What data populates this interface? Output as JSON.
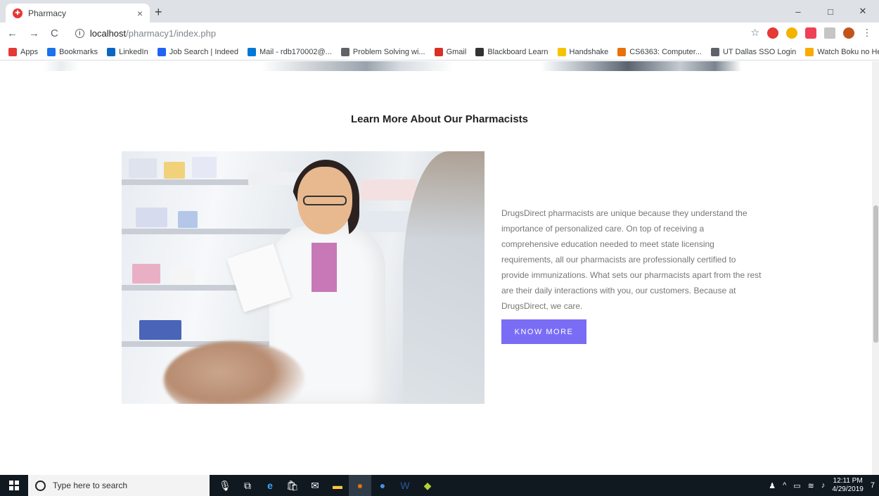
{
  "browser": {
    "tab_title": "Pharmacy",
    "tab_close": "×",
    "new_tab": "+",
    "url_host": "localhost",
    "url_path": "/pharmacy1/index.php",
    "window_minimize": "–",
    "window_maximize": "□",
    "window_close": "✕",
    "back": "←",
    "forward": "→",
    "reload": "C",
    "bookmarks": [
      {
        "label": "Apps",
        "color": "#e53935"
      },
      {
        "label": "Bookmarks",
        "color": "#1a73e8"
      },
      {
        "label": "LinkedIn",
        "color": "#0a66c2"
      },
      {
        "label": "Job Search | Indeed",
        "color": "#2164f3"
      },
      {
        "label": "Mail - rdb170002@...",
        "color": "#0078d4"
      },
      {
        "label": "Problem Solving wi...",
        "color": "#5f6368"
      },
      {
        "label": "Gmail",
        "color": "#d93025"
      },
      {
        "label": "Blackboard Learn",
        "color": "#333333"
      },
      {
        "label": "Handshake",
        "color": "#f5c400"
      },
      {
        "label": "CS6363: Computer...",
        "color": "#e8710a"
      },
      {
        "label": "UT Dallas SSO Login",
        "color": "#5f6368"
      },
      {
        "label": "Watch Boku no Her...",
        "color": "#f9ab00"
      }
    ],
    "bookmarks_more": "»"
  },
  "section": {
    "title": "Learn More About Our Pharmacists",
    "description": "DrugsDirect pharmacists are unique because they understand the importance of personalized care. On top of receiving a comprehensive education needed to meet state licensing requirements, all our pharmacists are professionally certified to provide immunizations. What sets our pharmacists apart from the rest are their daily interactions with you, our customers. Because at DrugsDirect, we care.",
    "button_label": "KNOW MORE"
  },
  "taskbar": {
    "search_placeholder": "Type here to search",
    "time": "12:11 PM",
    "date": "4/29/2019",
    "notification_count": "7"
  },
  "colors": {
    "accent": "#7b6cf6",
    "text_muted": "#777777",
    "taskbar_bg": "#101820"
  }
}
